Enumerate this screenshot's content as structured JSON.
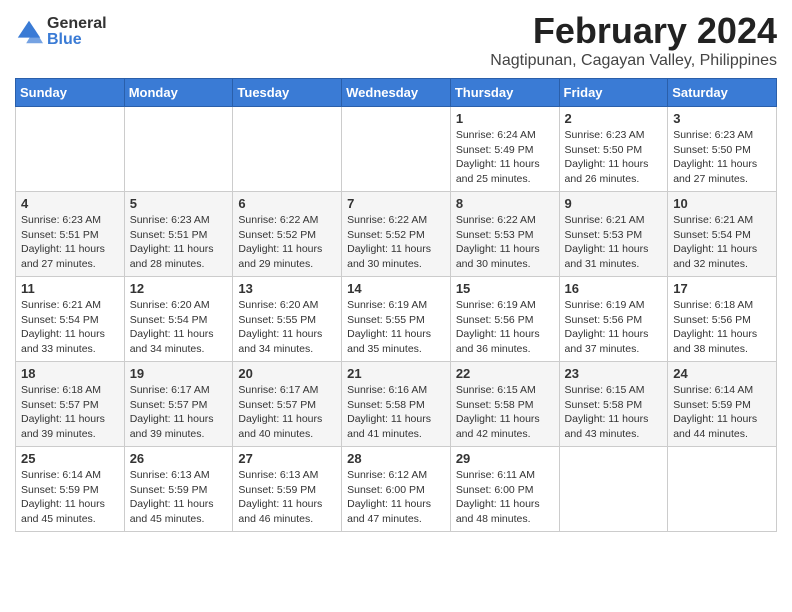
{
  "logo": {
    "general": "General",
    "blue": "Blue"
  },
  "title": "February 2024",
  "subtitle": "Nagtipunan, Cagayan Valley, Philippines",
  "days_of_week": [
    "Sunday",
    "Monday",
    "Tuesday",
    "Wednesday",
    "Thursday",
    "Friday",
    "Saturday"
  ],
  "weeks": [
    [
      {
        "day": "",
        "info": ""
      },
      {
        "day": "",
        "info": ""
      },
      {
        "day": "",
        "info": ""
      },
      {
        "day": "",
        "info": ""
      },
      {
        "day": "1",
        "info": "Sunrise: 6:24 AM\nSunset: 5:49 PM\nDaylight: 11 hours and 25 minutes."
      },
      {
        "day": "2",
        "info": "Sunrise: 6:23 AM\nSunset: 5:50 PM\nDaylight: 11 hours and 26 minutes."
      },
      {
        "day": "3",
        "info": "Sunrise: 6:23 AM\nSunset: 5:50 PM\nDaylight: 11 hours and 27 minutes."
      }
    ],
    [
      {
        "day": "4",
        "info": "Sunrise: 6:23 AM\nSunset: 5:51 PM\nDaylight: 11 hours and 27 minutes."
      },
      {
        "day": "5",
        "info": "Sunrise: 6:23 AM\nSunset: 5:51 PM\nDaylight: 11 hours and 28 minutes."
      },
      {
        "day": "6",
        "info": "Sunrise: 6:22 AM\nSunset: 5:52 PM\nDaylight: 11 hours and 29 minutes."
      },
      {
        "day": "7",
        "info": "Sunrise: 6:22 AM\nSunset: 5:52 PM\nDaylight: 11 hours and 30 minutes."
      },
      {
        "day": "8",
        "info": "Sunrise: 6:22 AM\nSunset: 5:53 PM\nDaylight: 11 hours and 30 minutes."
      },
      {
        "day": "9",
        "info": "Sunrise: 6:21 AM\nSunset: 5:53 PM\nDaylight: 11 hours and 31 minutes."
      },
      {
        "day": "10",
        "info": "Sunrise: 6:21 AM\nSunset: 5:54 PM\nDaylight: 11 hours and 32 minutes."
      }
    ],
    [
      {
        "day": "11",
        "info": "Sunrise: 6:21 AM\nSunset: 5:54 PM\nDaylight: 11 hours and 33 minutes."
      },
      {
        "day": "12",
        "info": "Sunrise: 6:20 AM\nSunset: 5:54 PM\nDaylight: 11 hours and 34 minutes."
      },
      {
        "day": "13",
        "info": "Sunrise: 6:20 AM\nSunset: 5:55 PM\nDaylight: 11 hours and 34 minutes."
      },
      {
        "day": "14",
        "info": "Sunrise: 6:19 AM\nSunset: 5:55 PM\nDaylight: 11 hours and 35 minutes."
      },
      {
        "day": "15",
        "info": "Sunrise: 6:19 AM\nSunset: 5:56 PM\nDaylight: 11 hours and 36 minutes."
      },
      {
        "day": "16",
        "info": "Sunrise: 6:19 AM\nSunset: 5:56 PM\nDaylight: 11 hours and 37 minutes."
      },
      {
        "day": "17",
        "info": "Sunrise: 6:18 AM\nSunset: 5:56 PM\nDaylight: 11 hours and 38 minutes."
      }
    ],
    [
      {
        "day": "18",
        "info": "Sunrise: 6:18 AM\nSunset: 5:57 PM\nDaylight: 11 hours and 39 minutes."
      },
      {
        "day": "19",
        "info": "Sunrise: 6:17 AM\nSunset: 5:57 PM\nDaylight: 11 hours and 39 minutes."
      },
      {
        "day": "20",
        "info": "Sunrise: 6:17 AM\nSunset: 5:57 PM\nDaylight: 11 hours and 40 minutes."
      },
      {
        "day": "21",
        "info": "Sunrise: 6:16 AM\nSunset: 5:58 PM\nDaylight: 11 hours and 41 minutes."
      },
      {
        "day": "22",
        "info": "Sunrise: 6:15 AM\nSunset: 5:58 PM\nDaylight: 11 hours and 42 minutes."
      },
      {
        "day": "23",
        "info": "Sunrise: 6:15 AM\nSunset: 5:58 PM\nDaylight: 11 hours and 43 minutes."
      },
      {
        "day": "24",
        "info": "Sunrise: 6:14 AM\nSunset: 5:59 PM\nDaylight: 11 hours and 44 minutes."
      }
    ],
    [
      {
        "day": "25",
        "info": "Sunrise: 6:14 AM\nSunset: 5:59 PM\nDaylight: 11 hours and 45 minutes."
      },
      {
        "day": "26",
        "info": "Sunrise: 6:13 AM\nSunset: 5:59 PM\nDaylight: 11 hours and 45 minutes."
      },
      {
        "day": "27",
        "info": "Sunrise: 6:13 AM\nSunset: 5:59 PM\nDaylight: 11 hours and 46 minutes."
      },
      {
        "day": "28",
        "info": "Sunrise: 6:12 AM\nSunset: 6:00 PM\nDaylight: 11 hours and 47 minutes."
      },
      {
        "day": "29",
        "info": "Sunrise: 6:11 AM\nSunset: 6:00 PM\nDaylight: 11 hours and 48 minutes."
      },
      {
        "day": "",
        "info": ""
      },
      {
        "day": "",
        "info": ""
      }
    ]
  ]
}
